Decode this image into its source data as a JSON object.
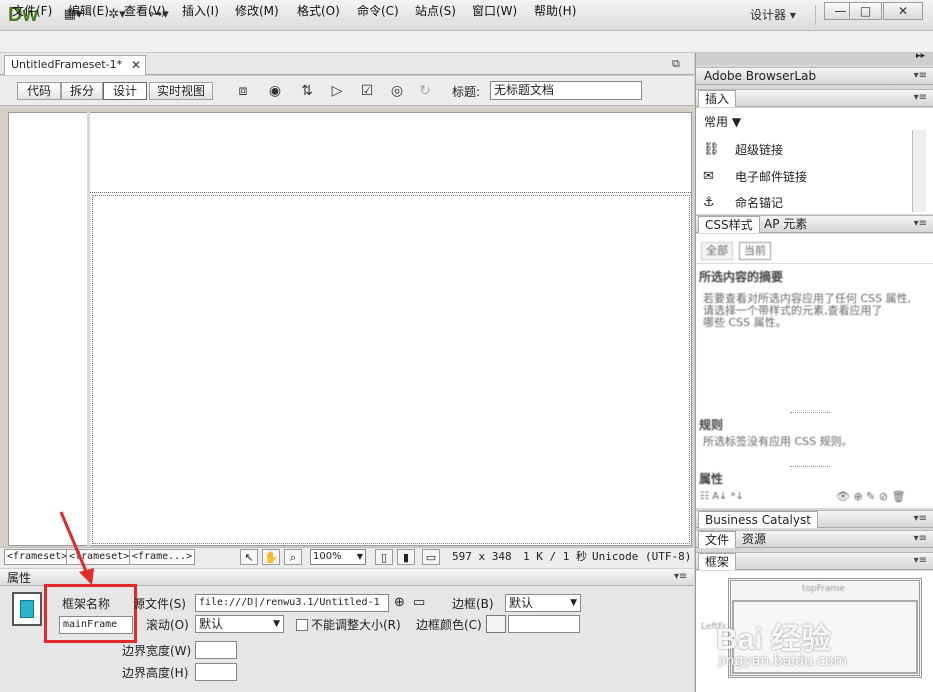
{
  "app": {
    "logo": "Dw",
    "workspace": "设计器",
    "workspace_arrow": "▾",
    "win_min": "—",
    "win_max": "□",
    "win_close": "✕"
  },
  "menu": [
    "文件(F)",
    "编辑(E)",
    "查看(V)",
    "插入(I)",
    "修改(M)",
    "格式(O)",
    "命令(C)",
    "站点(S)",
    "窗口(W)",
    "帮助(H)"
  ],
  "document": {
    "tab_name": "UntitledFrameset-1*",
    "tab_close": "✕",
    "views": [
      "代码",
      "拆分",
      "设计",
      "实时视图"
    ],
    "active_view": "设计",
    "title_label": "标题:",
    "title_value": "无标题文档"
  },
  "status": {
    "tags": [
      "<frameset>",
      "<frameset>",
      "<frame...>"
    ],
    "zoom": "100%",
    "size": "597 x 348",
    "weight": "1 K / 1 秒",
    "encoding": "Unicode (UTF-8)"
  },
  "properties": {
    "header": "属性",
    "frame_name_label": "框架名称",
    "frame_name_value": "mainFrame",
    "src_label": "源文件(S)",
    "src_value": "file:///D|/renwu3.1/Untitled-1",
    "border_label": "边框(B)",
    "border_value": "默认",
    "scroll_label": "滚动(O)",
    "scroll_value": "默认",
    "noresize_label": "不能调整大小(R)",
    "border_color_label": "边框颜色(C)",
    "margin_width_label": "边界宽度(W)",
    "margin_height_label": "边界高度(H)"
  },
  "panels": {
    "browserlab": "Adobe BrowserLab",
    "insert_tab": "插入",
    "insert_category": "常用",
    "insert_items": [
      "超级链接",
      "电子邮件链接",
      "命名锚记"
    ],
    "css_tab": "CSS样式",
    "ap_tab": "AP 元素",
    "css_all": "全部",
    "css_current": "当前",
    "css_summary_title": "所选内容的摘要",
    "css_summary_text_1": "若要查看对所选内容应用了任何 CSS 属性,",
    "css_summary_text_2": "请选择一个带样式的元素,查看应用了",
    "css_summary_text_3": "哪些 CSS 属性。",
    "rules_title": "规则",
    "rules_text": "所选标签没有应用 CSS 规则。",
    "props_title": "属性",
    "bc_tab": "Business Catalyst",
    "files_tab": "文件",
    "assets_tab": "资源",
    "frames_tab": "框架",
    "top_frame": "topFrame",
    "left_frame_label": "LeftFr"
  },
  "watermark": {
    "main": "Bai 经验",
    "sub": "jingyan.baidu.com"
  }
}
